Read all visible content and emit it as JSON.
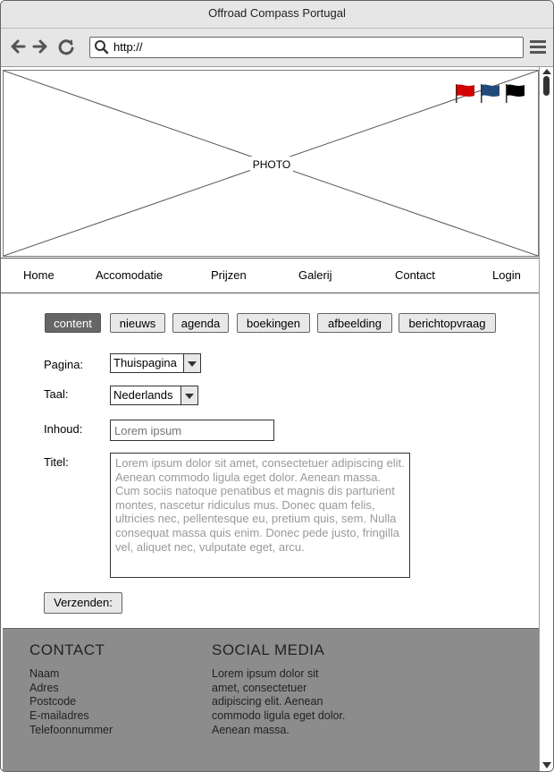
{
  "window": {
    "title": "Offroad Compass Portugal"
  },
  "browser": {
    "url": "http://",
    "back_icon": "arrow-left-icon",
    "forward_icon": "arrow-right-icon",
    "reload_icon": "reload-icon",
    "search_icon": "search-icon",
    "menu_icon": "hamburger-menu-icon"
  },
  "hero": {
    "photo_label": "PHOTO",
    "flags": [
      {
        "color": "#d40000"
      },
      {
        "color": "#1f4a7a"
      },
      {
        "color": "#000000"
      }
    ]
  },
  "nav": {
    "items": [
      "Home",
      "Accomodatie",
      "Prijzen",
      "Galerij",
      "Contact",
      "Login"
    ]
  },
  "tabs": {
    "items": [
      "content",
      "nieuws",
      "agenda",
      "boekingen",
      "afbeelding",
      "berichtopvraag"
    ],
    "active": "content"
  },
  "form": {
    "pagina_label": "Pagina:",
    "pagina_value": "Thuispagina",
    "taal_label": "Taal:",
    "taal_value": "Nederlands",
    "inhoud_label": "Inhoud:",
    "inhoud_placeholder": "Lorem ipsum",
    "titel_label": "Titel:",
    "titel_value": "Lorem ipsum dolor sit amet, consectetuer adipiscing elit. Aenean commodo ligula eget dolor. Aenean massa. Cum sociis natoque penatibus et magnis dis parturient montes, nascetur ridiculus mus. Donec quam felis, ultricies nec, pellentesque eu, pretium quis, sem. Nulla consequat massa quis enim. Donec pede justo, fringilla vel, aliquet nec, vulputate eget, arcu.",
    "submit_label": "Verzenden:"
  },
  "footer": {
    "contact_title": "CONTACT",
    "contact_items": [
      "Naam",
      "Adres",
      "Postcode",
      "E-mailadres",
      "Telefoonnummer"
    ],
    "social_title": "SOCIAL MEDIA",
    "social_lines": [
      "Lorem ipsum dolor sit",
      "amet, consectetuer",
      "adipiscing elit. Aenean",
      "commodo ligula eget dolor.",
      "Aenean massa."
    ]
  },
  "colors": {
    "chrome": "#e6e6e6",
    "footer_bg": "#8c8c8c",
    "active_tab": "#666666"
  }
}
